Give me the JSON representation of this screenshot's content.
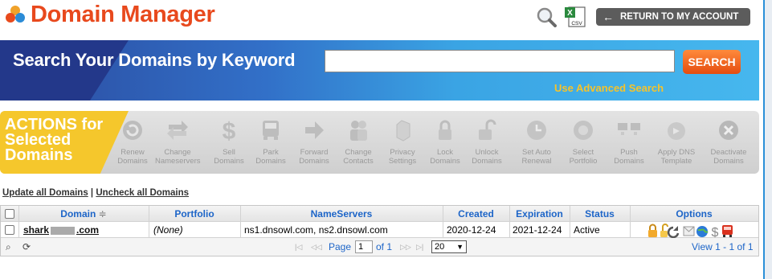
{
  "header": {
    "title": "Domain Manager",
    "return_label": "RETURN TO MY ACCOUNT",
    "csv_label": "CSV"
  },
  "search": {
    "label": "Search Your Domains by Keyword",
    "value": "",
    "button_label": "SEARCH",
    "advanced_link": "Use Advanced Search"
  },
  "actions": {
    "title_line1": "ACTIONS for",
    "title_line2": "Selected",
    "title_line3": "Domains",
    "items": [
      {
        "line1": "Renew",
        "line2": "Domains",
        "icon": "renew-icon"
      },
      {
        "line1": "Change",
        "line2": "Nameservers",
        "icon": "change-nameservers-icon"
      },
      {
        "line1": "Sell",
        "line2": "Domains",
        "icon": "dollar-icon"
      },
      {
        "line1": "Park",
        "line2": "Domains",
        "icon": "park-icon"
      },
      {
        "line1": "Forward",
        "line2": "Domains",
        "icon": "forward-arrow-icon"
      },
      {
        "line1": "Change",
        "line2": "Contacts",
        "icon": "contacts-icon"
      },
      {
        "line1": "Privacy",
        "line2": "Settings",
        "icon": "privacy-icon"
      },
      {
        "line1": "Lock",
        "line2": "Domains",
        "icon": "lock-icon"
      },
      {
        "line1": "Unlock",
        "line2": "Domains",
        "icon": "unlock-icon"
      },
      {
        "line1": "Set Auto",
        "line2": "Renewal",
        "icon": "auto-renew-clock-icon"
      },
      {
        "line1": "Select",
        "line2": "Portfolio",
        "icon": "portfolio-icon"
      },
      {
        "line1": "Push",
        "line2": "Domains",
        "icon": "push-icon"
      },
      {
        "line1": "Apply DNS",
        "line2": "Template",
        "icon": "dns-template-icon"
      },
      {
        "line1": "Deactivate",
        "line2": "Domains",
        "icon": "deactivate-icon"
      }
    ]
  },
  "table": {
    "update_all": "Update all Domains",
    "divider": "|",
    "uncheck_all": "Uncheck all Domains",
    "columns": {
      "domain": "Domain",
      "portfolio": "Portfolio",
      "nameservers": "NameServers",
      "created": "Created",
      "expiration": "Expiration",
      "status": "Status",
      "options": "Options"
    },
    "sort_glyph": "≑",
    "rows": [
      {
        "domain_prefix": "shark",
        "domain_suffix": ".com",
        "portfolio": "(None)",
        "nameservers": "ns1.dnsowl.com, ns2.dnsowl.com",
        "created": "2020-12-24",
        "expiration": "2021-12-24",
        "status": "Active"
      }
    ]
  },
  "pager": {
    "page_label": "Page",
    "page_value": "1",
    "of_label": "of 1",
    "page_size": "20",
    "view_text": "View 1 - 1 of 1"
  },
  "colors": {
    "title": "#e8491d",
    "accent_link": "#1d65c8",
    "advanced": "#f6c32a",
    "actions_yellow": "#f5c72c"
  }
}
